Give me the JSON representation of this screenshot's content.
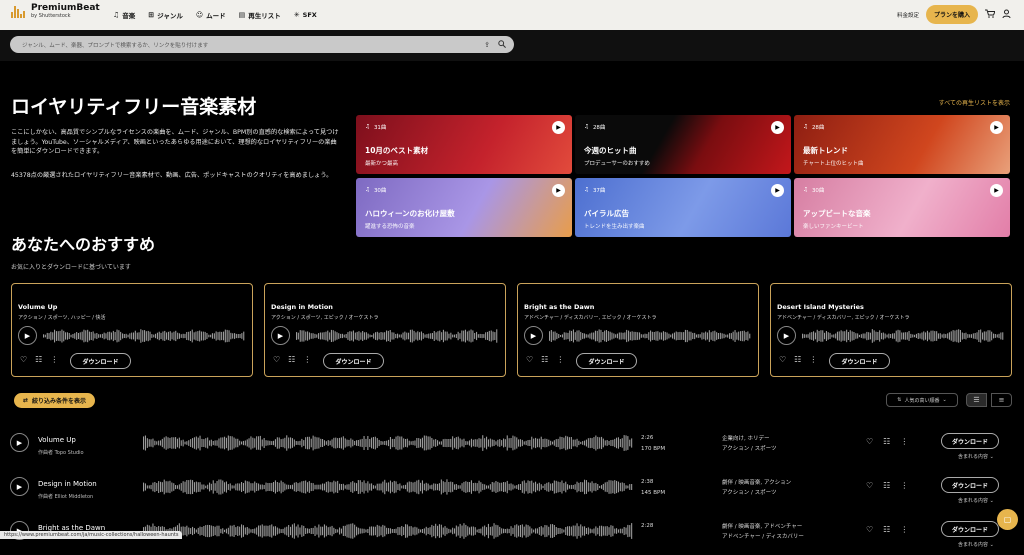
{
  "nav": {
    "logo_name": "PremiumBeat",
    "logo_sub": "by Shutterstock",
    "menu": [
      {
        "label": "音楽",
        "icon": "♫"
      },
      {
        "label": "ジャンル",
        "icon": "⊞"
      },
      {
        "label": "ムード",
        "icon": "☺"
      },
      {
        "label": "再生リスト",
        "icon": "▤"
      },
      {
        "label": "SFX",
        "icon": "✳"
      }
    ],
    "pricing": "料金設定",
    "buy": "プランを購入",
    "cart_icon": "🛒",
    "account_icon": "👤"
  },
  "search": {
    "placeholder": "ジャンル、ムード、楽器、プロンプトで検索するか、リンクを貼り付けます"
  },
  "hero": {
    "title": "ロイヤリティフリー音楽素材",
    "desc": "ここにしかない、高品質でシンプルなライセンスの楽曲を、ムード、ジャンル、BPM別の直感的な検索によって見つけましょう。YouTube、ソーシャルメディア、映画といったあらゆる用途において、理想的なロイヤリティフリーの楽曲を簡単にダウンロードできます。",
    "desc2": "45378点の厳選されたロイヤリティフリー音楽素材で、動画、広告、ポッドキャストのクオリティを高めましょう。",
    "all_playlists": "すべての再生リストを表示"
  },
  "playlists": [
    {
      "count": "31曲",
      "title": "10月のベスト素材",
      "subtitle": "最新かつ最高",
      "color": "#b41c2a"
    },
    {
      "count": "28曲",
      "title": "今週のヒット曲",
      "subtitle": "プロデューサーのおすすめ",
      "color": "#111111"
    },
    {
      "count": "28曲",
      "title": "最新トレンド",
      "subtitle": "チャート上位のヒット曲",
      "color": "#c1361f"
    },
    {
      "count": "30曲",
      "title": "ハロウィーンのお化け屋敷",
      "subtitle": "躍進する恐怖の音楽",
      "color": "#8e7ad0"
    },
    {
      "count": "37曲",
      "title": "バイラル広告",
      "subtitle": "トレンドを生み出す楽曲",
      "color": "#5a7bd6"
    },
    {
      "count": "30曲",
      "title": "アップビートな音楽",
      "subtitle": "楽しいファンキービート",
      "color": "#e08fb1"
    }
  ],
  "recommend": {
    "title": "あなたへのおすすめ",
    "subtitle": "お気に入りとダウンロードに基づいています",
    "download": "ダウンロード",
    "cards": [
      {
        "title": "Volume Up",
        "tags": "アクション / スポーツ, ハッピー / 快活"
      },
      {
        "title": "Design in Motion",
        "tags": "アクション / スポーツ, エピック / オーケストラ"
      },
      {
        "title": "Bright as the Dawn",
        "tags": "アドベンチャー / ディスカバリー, エピック / オーケストラ"
      },
      {
        "title": "Desert Island Mysteries",
        "tags": "アドベンチャー / ディスカバリー, エピック / オーケストラ"
      }
    ]
  },
  "list": {
    "filter": "絞り込み条件を表示",
    "sort": "人気の高い順番",
    "download": "ダウンロード",
    "includes": "含まれる内容 ⌄",
    "tracks": [
      {
        "title": "Volume Up",
        "artist": "作曲者 Topo Studio",
        "duration": "2:26",
        "bpm": "170 BPM",
        "tag1": "企業向け, ホリデー",
        "tag2": "アクション / スポーツ"
      },
      {
        "title": "Design in Motion",
        "artist": "作曲者 Elliot Middleton",
        "duration": "2:38",
        "bpm": "145 BPM",
        "tag1": "劇伴 / 映画音楽, アクション",
        "tag2": "アクション / スポーツ"
      },
      {
        "title": "Bright as the Dawn",
        "artist": "",
        "duration": "2:28",
        "bpm": "",
        "tag1": "劇伴 / 映画音楽, アドベンチャー",
        "tag2": "アドベンチャー / ディスカバリー"
      }
    ]
  },
  "status_url": "https://www.premiumbeat.com/ja/music-collections/halloween-haunts"
}
